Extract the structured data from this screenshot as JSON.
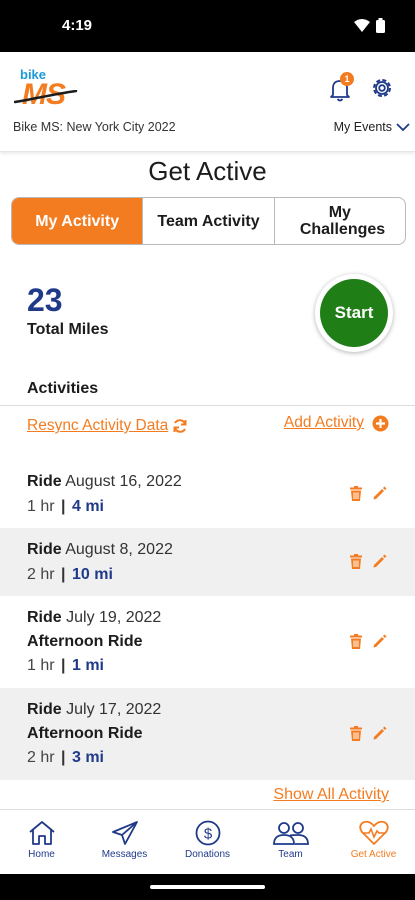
{
  "status": {
    "time": "4:19"
  },
  "header": {
    "logo_bike": "bike",
    "logo_ms": "MS",
    "event_name": "Bike MS: New York City 2022",
    "my_events_label": "My Events",
    "notification_count": "1"
  },
  "page": {
    "title": "Get Active"
  },
  "tabs": [
    {
      "label": "My Activity",
      "active": true
    },
    {
      "label": "Team Activity",
      "active": false
    },
    {
      "label": "My Challenges",
      "active": false
    }
  ],
  "summary": {
    "miles": "23",
    "miles_label": "Total Miles",
    "start_label": "Start"
  },
  "activities_section": {
    "label": "Activities",
    "resync_label": "Resync Activity Data",
    "add_label": "Add Activity",
    "show_all_label": "Show All Activity"
  },
  "activities": [
    {
      "type": "Ride",
      "date": "August 16, 2022",
      "subtitle": "",
      "duration": "1 hr",
      "distance": "4 mi"
    },
    {
      "type": "Ride",
      "date": "August 8, 2022",
      "subtitle": "",
      "duration": "2 hr",
      "distance": "10 mi"
    },
    {
      "type": "Ride",
      "date": "July 19, 2022",
      "subtitle": "Afternoon Ride",
      "duration": "1 hr",
      "distance": "1 mi"
    },
    {
      "type": "Ride",
      "date": "July 17, 2022",
      "subtitle": "Afternoon Ride",
      "duration": "2 hr",
      "distance": "3 mi"
    }
  ],
  "separator": "|",
  "nav": [
    {
      "label": "Home",
      "icon": "home-icon"
    },
    {
      "label": "Messages",
      "icon": "paper-plane-icon"
    },
    {
      "label": "Donations",
      "icon": "dollar-coin-icon"
    },
    {
      "label": "Team",
      "icon": "team-icon"
    },
    {
      "label": "Get Active",
      "icon": "heart-pulse-icon",
      "active": true
    }
  ],
  "colors": {
    "accent": "#f47c20",
    "navy": "#203a8a",
    "start_green": "#1f7e16",
    "logo_blue": "#1c9ad6"
  }
}
